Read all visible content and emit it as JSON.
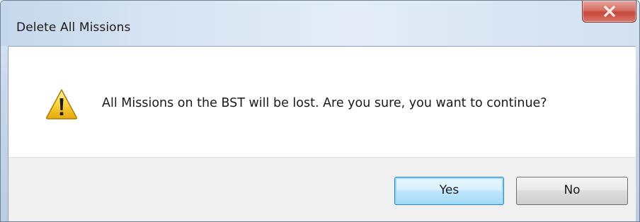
{
  "dialog": {
    "title": "Delete All Missions",
    "message": "All Missions on the BST will be lost. Are you sure, you want to continue?",
    "icon": "warning-icon",
    "close_icon": "close-icon"
  },
  "buttons": {
    "yes_label": "Yes",
    "no_label": "No"
  },
  "colors": {
    "close_button": "#c5483a",
    "default_button_border": "#3c7fb1",
    "footer_background": "#f0f0f0"
  }
}
